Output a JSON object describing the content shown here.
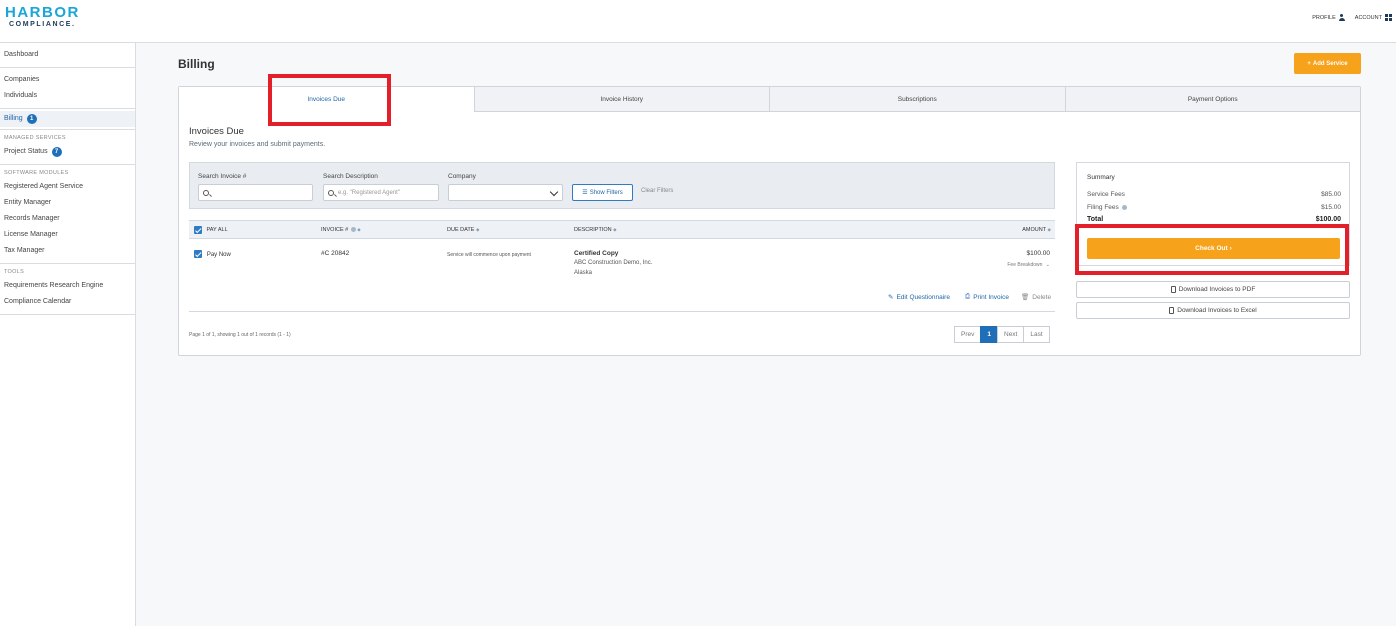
{
  "brand": {
    "line1": "HARBOR",
    "line2": "COMPLIANCE."
  },
  "header": {
    "profile": "PROFILE",
    "account": "ACCOUNT"
  },
  "sidebar": {
    "dashboard": "Dashboard",
    "companies": "Companies",
    "individuals": "Individuals",
    "billing": "Billing",
    "billing_badge": "1",
    "managed_heading": "MANAGED SERVICES",
    "project_status": "Project Status",
    "project_badge": "7",
    "software_heading": "SOFTWARE MODULES",
    "registered_agent": "Registered Agent Service",
    "entity_manager": "Entity Manager",
    "records_manager": "Records Manager",
    "license_manager": "License Manager",
    "tax_manager": "Tax Manager",
    "tools_heading": "TOOLS",
    "requirements": "Requirements Research Engine",
    "calendar": "Compliance Calendar"
  },
  "page": {
    "title": "Billing",
    "add_service": "Add Service"
  },
  "tabs": [
    "Invoices Due",
    "Invoice History",
    "Subscriptions",
    "Payment Options"
  ],
  "section": {
    "title": "Invoices Due",
    "subtitle": "Review your invoices and submit payments."
  },
  "filters": {
    "invoice_label": "Search Invoice #",
    "description_label": "Search Description",
    "description_placeholder": "e.g. \"Registered Agent\"",
    "company_label": "Company",
    "show_filters": "Show Filters",
    "clear_filters": "Clear Filters"
  },
  "table": {
    "headers": {
      "pay_all": "PAY ALL",
      "invoice": "INVOICE #",
      "due_date": "DUE DATE",
      "description": "DESCRIPTION",
      "amount": "AMOUNT"
    },
    "row": {
      "pay": "Pay Now",
      "invoice": "#C 20842",
      "due": "Service will commence upon payment",
      "desc_title": "Certified Copy",
      "desc_company": "ABC Construction Demo, Inc.",
      "desc_state": "Alaska",
      "amount": "$100.00",
      "fee_breakdown": "Fee Breakdown"
    },
    "actions": {
      "edit": "Edit Questionnaire",
      "print": "Print Invoice",
      "delete": "Delete"
    }
  },
  "pagination": {
    "text": "Page 1 of 1, showing 1 out of 1 records (1 - 1)",
    "prev": "Prev",
    "current": "1",
    "next": "Next",
    "last": "Last"
  },
  "summary": {
    "title": "Summary",
    "service_label": "Service Fees",
    "service_value": "$85.00",
    "filing_label": "Filing Fees",
    "filing_value": "$15.00",
    "total_label": "Total",
    "total_value": "$100.00",
    "checkout": "Check Out",
    "pdf": "Download Invoices to PDF",
    "excel": "Download Invoices to Excel"
  },
  "colors": {
    "accent": "#f7a21b",
    "primary": "#1f6fb8",
    "highlight": "#e3202a"
  }
}
